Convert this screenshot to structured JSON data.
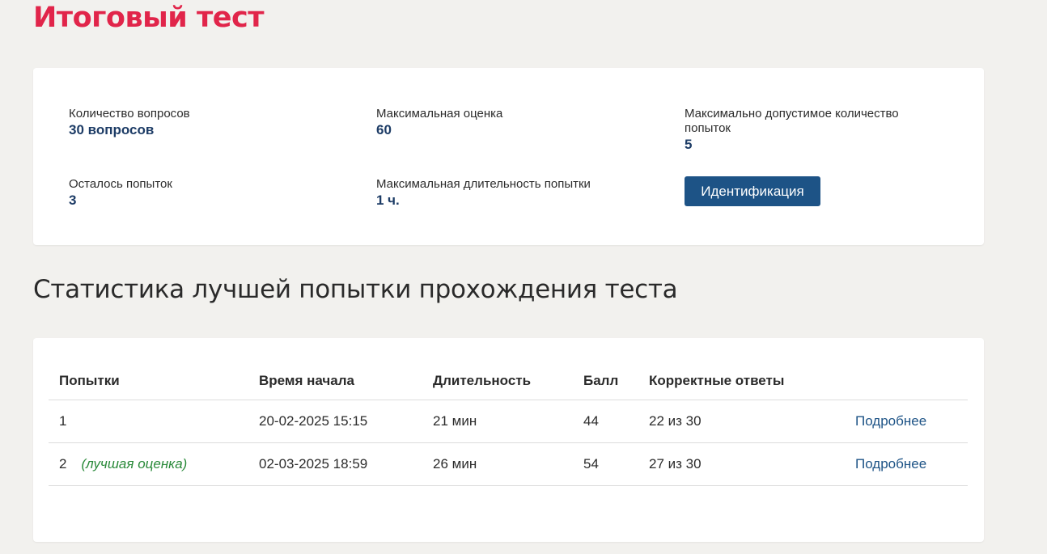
{
  "page": {
    "title": "Итоговый тест"
  },
  "info": {
    "questions_label": "Количество вопросов",
    "questions_value": "30 вопросов",
    "max_score_label": "Максимальная оценка",
    "max_score_value": "60",
    "max_attempts_label": "Максимально допустимое количество попыток",
    "max_attempts_value": "5",
    "remaining_label": "Осталось попыток",
    "remaining_value": "3",
    "max_duration_label": "Максимальная длительность попытки",
    "max_duration_value": "1 ч.",
    "ident_button": "Идентификация"
  },
  "stats": {
    "title": "Статистика лучшей попытки прохождения теста",
    "columns": [
      "Попытки",
      "Время начала",
      "Длительность",
      "Балл",
      "Корректные ответы"
    ],
    "rows": [
      {
        "attempt": "1",
        "tag": "",
        "start": "20-02-2025 15:15",
        "duration": "21 мин",
        "score": "44",
        "correct": "22 из 30",
        "link": "Подробнее"
      },
      {
        "attempt": "2",
        "tag": "(лучшая оценка)",
        "start": "02-03-2025 18:59",
        "duration": "26 мин",
        "score": "54",
        "correct": "27 из 30",
        "link": "Подробнее"
      }
    ]
  },
  "colors": {
    "title": "#e1254a",
    "accent": "#1d5386",
    "value": "#1d3c66",
    "best": "#2a8a3a",
    "background": "#f2f1ee"
  }
}
